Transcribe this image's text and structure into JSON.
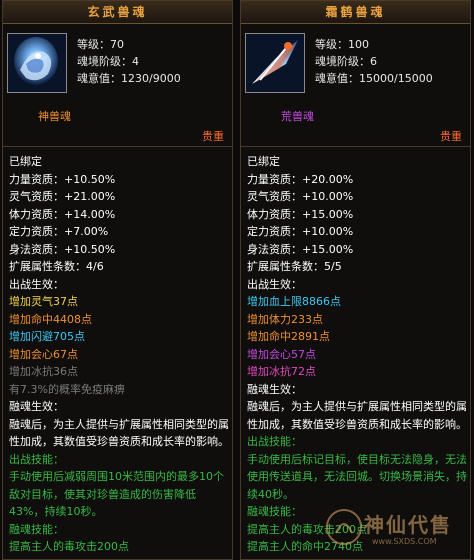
{
  "left": {
    "title": "玄武兽魂",
    "level": "等级：70",
    "realm": "魂境阶级：4",
    "soul": "魂意值：1230/9000",
    "type": "神兽魂",
    "rarity": "贵重",
    "lines": [
      {
        "t": "已绑定",
        "c": "white"
      },
      {
        "t": "力量资质：+10.50%",
        "c": "white"
      },
      {
        "t": "灵气资质：+21.00%",
        "c": "white"
      },
      {
        "t": "体力资质：+14.00%",
        "c": "white"
      },
      {
        "t": "定力资质：+7.00%",
        "c": "white"
      },
      {
        "t": "身法资质：+10.50%",
        "c": "white"
      },
      {
        "t": "扩展属性条数：4/6",
        "c": "white"
      },
      {
        "t": "出战生效：",
        "c": "white"
      },
      {
        "t": "增加灵气37点",
        "c": "yellow"
      },
      {
        "t": "增加命中4408点",
        "c": "orange"
      },
      {
        "t": "增加闪避705点",
        "c": "cyan"
      },
      {
        "t": "增加会心67点",
        "c": "orange"
      },
      {
        "t": "增加冰抗36点",
        "c": "gray"
      },
      {
        "t": "有7.3%的概率免疫麻痹",
        "c": "gray"
      },
      {
        "t": "融魂生效：",
        "c": "white"
      },
      {
        "t": "融魂后，为主人提供与扩展属性相同类型的属性加成，其数值受珍兽资质和成长率的影响。",
        "c": "white",
        "w": true
      },
      {
        "t": "出战技能：",
        "c": "green"
      },
      {
        "t": "手动使用后减弱周围10米范围内的最多10个敌对目标，使其对珍兽造成的伤害降低43%，持续10秒。",
        "c": "green",
        "w": true
      },
      {
        "t": "融魂技能：",
        "c": "green"
      },
      {
        "t": "提高主人的毒攻击200点",
        "c": "green"
      }
    ]
  },
  "right": {
    "title": "霜鹤兽魂",
    "level": "等级：100",
    "realm": "魂境阶级：6",
    "soul": "魂意值：15000/15000",
    "type": "荒兽魂",
    "rarity": "贵重",
    "lines": [
      {
        "t": "已绑定",
        "c": "white"
      },
      {
        "t": "力量资质：+20.00%",
        "c": "white"
      },
      {
        "t": "灵气资质：+10.00%",
        "c": "white"
      },
      {
        "t": "体力资质：+15.00%",
        "c": "white"
      },
      {
        "t": "定力资质：+10.00%",
        "c": "white"
      },
      {
        "t": "身法资质：+15.00%",
        "c": "white"
      },
      {
        "t": "扩展属性条数：5/5",
        "c": "white"
      },
      {
        "t": "出战生效：",
        "c": "white"
      },
      {
        "t": "增加血上限8866点",
        "c": "cyan"
      },
      {
        "t": "增加体力233点",
        "c": "orange"
      },
      {
        "t": "增加命中2891点",
        "c": "orange"
      },
      {
        "t": "增加会心57点",
        "c": "purple"
      },
      {
        "t": "增加冰抗72点",
        "c": "pink"
      },
      {
        "t": "融魂生效：",
        "c": "white"
      },
      {
        "t": "融魂后，为主人提供与扩展属性相同类型的属性加成，其数值受珍兽资质和成长率的影响。",
        "c": "white",
        "w": true
      },
      {
        "t": "出战技能：",
        "c": "green"
      },
      {
        "t": "手动使用后标记目标，使目标无法隐身，无法使用传送道具，无法回城。切换场景消失，持续40秒。",
        "c": "green",
        "w": true
      },
      {
        "t": "融魂技能：",
        "c": "green"
      },
      {
        "t": "提高主人的毒攻击200点",
        "c": "green"
      },
      {
        "t": "提高主人的命中2740点",
        "c": "green"
      }
    ]
  },
  "watermark": {
    "text": "神仙代售",
    "url": "www.SXDS.COM"
  }
}
